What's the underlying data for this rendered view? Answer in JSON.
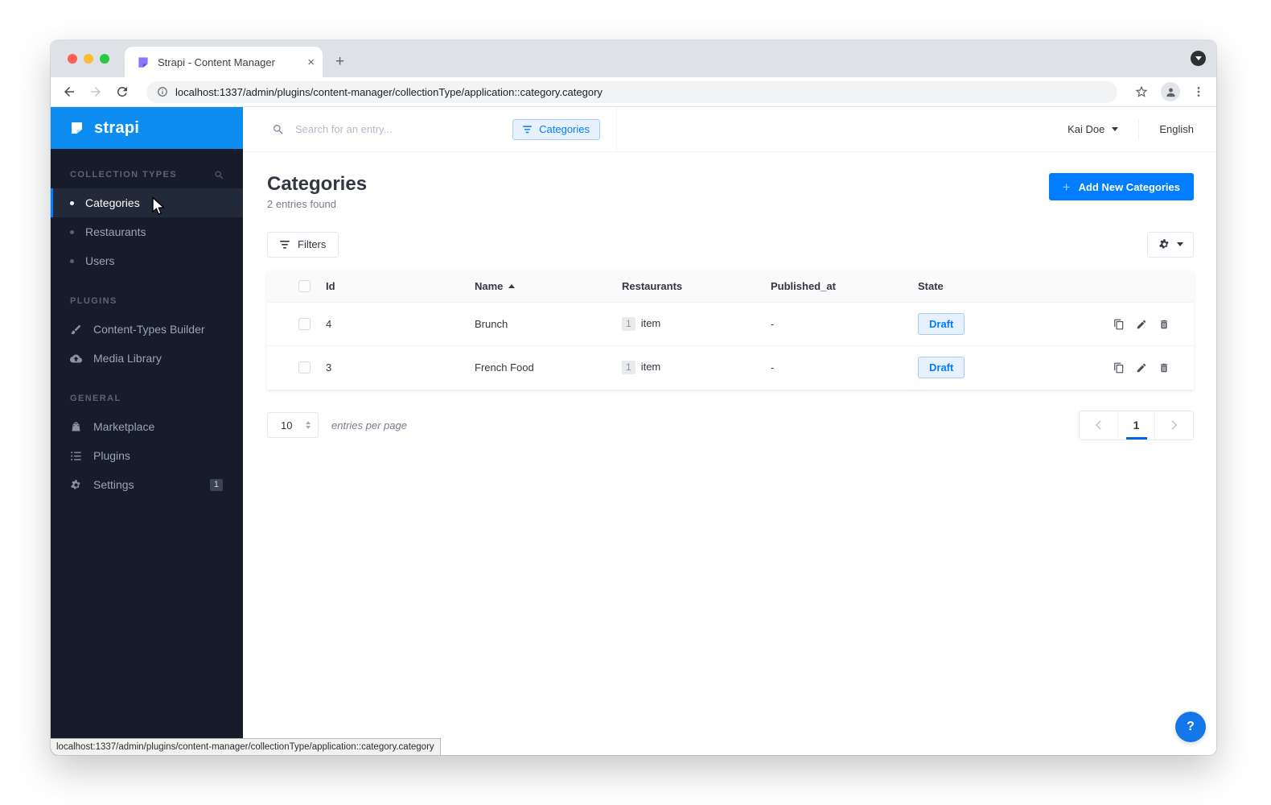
{
  "browser": {
    "tab_title": "Strapi - Content Manager",
    "url": "localhost:1337/admin/plugins/content-manager/collectionType/application::category.category",
    "status_url": "localhost:1337/admin/plugins/content-manager/collectionType/application::category.category"
  },
  "topbar": {
    "search_placeholder": "Search for an entry...",
    "filter_chip_label": "Categories",
    "user_name": "Kai Doe",
    "language": "English"
  },
  "sidebar": {
    "logo_text": "strapi",
    "sections": [
      {
        "label": "COLLECTION TYPES",
        "items": [
          {
            "label": "Categories",
            "active": true
          },
          {
            "label": "Restaurants"
          },
          {
            "label": "Users"
          }
        ]
      },
      {
        "label": "PLUGINS",
        "items": [
          {
            "label": "Content-Types Builder",
            "icon": "brush-icon"
          },
          {
            "label": "Media Library",
            "icon": "cloud-upload-icon"
          }
        ]
      },
      {
        "label": "GENERAL",
        "items": [
          {
            "label": "Marketplace",
            "icon": "shopping-bag-icon"
          },
          {
            "label": "Plugins",
            "icon": "list-icon"
          },
          {
            "label": "Settings",
            "icon": "gear-icon",
            "badge": "1"
          }
        ]
      }
    ]
  },
  "page": {
    "title": "Categories",
    "entries_found": "2 entries found",
    "add_new_label": "Add New Categories",
    "filters_label": "Filters"
  },
  "table": {
    "columns": {
      "id": "Id",
      "name": "Name",
      "restaurants": "Restaurants",
      "published_at": "Published_at",
      "state": "State"
    },
    "sorted_column": "Name",
    "sort_direction": "asc",
    "rows": [
      {
        "id": "4",
        "name": "Brunch",
        "restaurants_count": "1",
        "restaurants_unit": "item",
        "published_at": "-",
        "state": "Draft"
      },
      {
        "id": "3",
        "name": "French Food",
        "restaurants_count": "1",
        "restaurants_unit": "item",
        "published_at": "-",
        "state": "Draft"
      }
    ]
  },
  "pagination": {
    "per_page": "10",
    "per_page_label": "entries per page",
    "page": "1"
  },
  "icons": {
    "close": "×",
    "plus": "+",
    "question": "?"
  },
  "colors": {
    "accent": "#007eff",
    "sidebar_bg": "#171c2a",
    "logo_bar_blue": "#0d8cf2",
    "draft_bg": "#e7f1fd",
    "draft_border": "#a4cdf8",
    "tab_strip": "#dee1e6",
    "help_fab": "#1377ea"
  }
}
